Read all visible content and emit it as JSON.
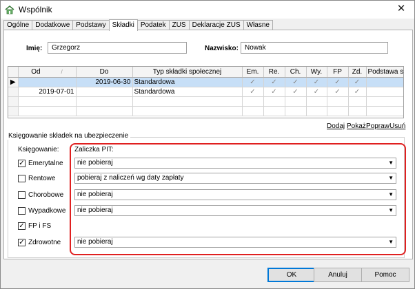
{
  "window": {
    "title": "Wspólnik",
    "close_glyph": "✕"
  },
  "tabs": [
    "Ogólne",
    "Dodatkowe",
    "Podstawy",
    "Składki",
    "Podatek",
    "ZUS",
    "Deklaracje ZUS",
    "Własne"
  ],
  "active_tab_index": 3,
  "person": {
    "first_name_label": "Imię:",
    "first_name": "Grzegorz",
    "last_name_label": "Nazwisko:",
    "last_name": "Nowak"
  },
  "grid": {
    "headers": [
      "Od",
      "Do",
      "Typ składki społecznej",
      "Em.",
      "Re.",
      "Ch.",
      "Wy.",
      "FP",
      "Zd.",
      "Podstawa skł."
    ],
    "rows": [
      {
        "od": "",
        "do": "2019-06-30",
        "typ": "Standardowa",
        "checks": [
          "✓",
          "✓",
          "✓",
          "✓",
          "✓",
          "✓"
        ],
        "selected": true,
        "indicator": "▶"
      },
      {
        "od": "2019-07-01",
        "do": "",
        "typ": "Standardowa",
        "checks": [
          "✓",
          "✓",
          "✓",
          "✓",
          "✓",
          "✓"
        ],
        "selected": false,
        "indicator": ""
      }
    ]
  },
  "links": {
    "add": "Dodaj",
    "show": "Pokaż",
    "edit": "Popraw",
    "delete": "Usuń"
  },
  "booking": {
    "group_title": "Księgowanie składek na ubezpieczenie",
    "column_label": "Księgowanie:",
    "pit_label": "Zaliczka PIT:",
    "items": [
      {
        "label": "Emerytalne",
        "checked": true,
        "pit": "nie pobieraj"
      },
      {
        "label": "Rentowe",
        "checked": false,
        "pit": "pobieraj z naliczeń wg daty zapłaty"
      },
      {
        "label": "Chorobowe",
        "checked": false,
        "pit": "nie pobieraj"
      },
      {
        "label": "Wypadkowe",
        "checked": false,
        "pit": "nie pobieraj"
      },
      {
        "label": "FP i FS",
        "checked": true,
        "pit": ""
      },
      {
        "label": "Zdrowotne",
        "checked": true,
        "pit": "nie pobieraj"
      }
    ]
  },
  "buttons": {
    "ok": "OK",
    "cancel": "Anuluj",
    "help": "Pomoc"
  },
  "colors": {
    "highlight": "#e02020",
    "selected_row": "#c7dff7",
    "default_button_border": "#0078d7"
  }
}
